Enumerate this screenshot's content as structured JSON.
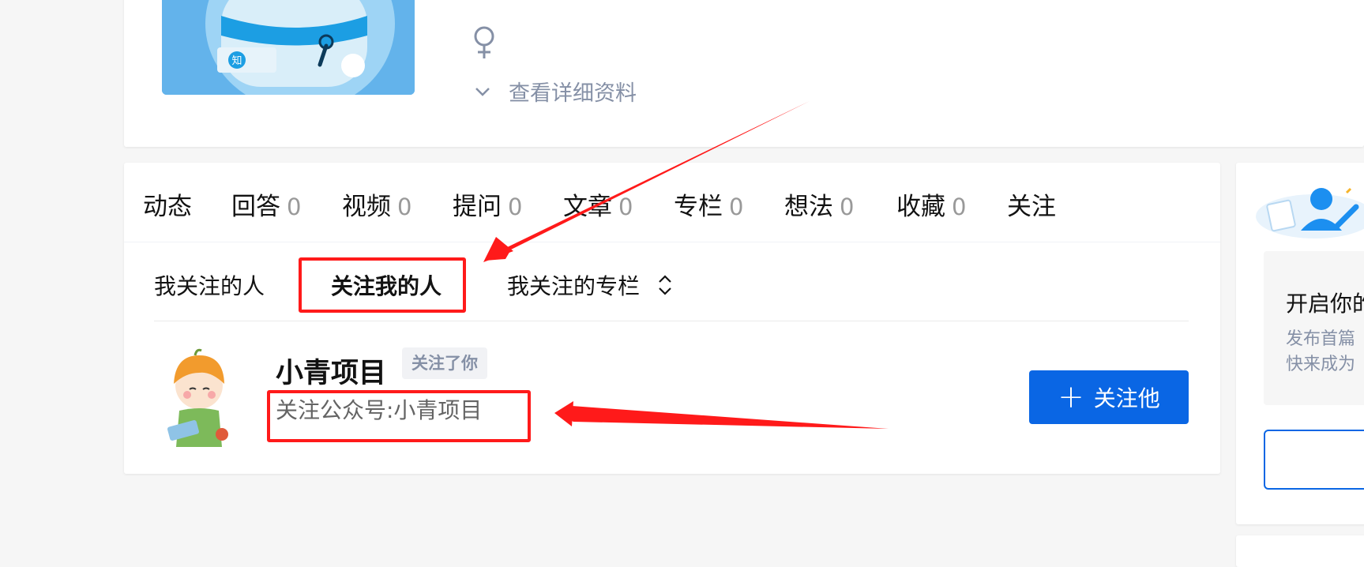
{
  "profile": {
    "cover_logo_text": "知",
    "gender_icon": "female-icon",
    "view_details_label": "查看详细资料"
  },
  "tabs": [
    {
      "label": "动态",
      "count": ""
    },
    {
      "label": "回答",
      "count": "0"
    },
    {
      "label": "视频",
      "count": "0"
    },
    {
      "label": "提问",
      "count": "0"
    },
    {
      "label": "文章",
      "count": "0"
    },
    {
      "label": "专栏",
      "count": "0"
    },
    {
      "label": "想法",
      "count": "0"
    },
    {
      "label": "收藏",
      "count": "0"
    },
    {
      "label": "关注",
      "count": ""
    }
  ],
  "subtabs": {
    "following": "我关注的人",
    "followers": "关注我的人",
    "columns": "我关注的专栏"
  },
  "follower": {
    "name": "小青项目",
    "badge": "关注了你",
    "bio": "关注公众号:小青项目",
    "follow_button": "关注他"
  },
  "sidebar": {
    "title": "开启你的",
    "desc_line1": "发布首篇",
    "desc_line2": "快来成为"
  },
  "colors": {
    "accent": "#0a66e4",
    "annotation": "#ff1a1a",
    "muted": "#8590a6"
  }
}
